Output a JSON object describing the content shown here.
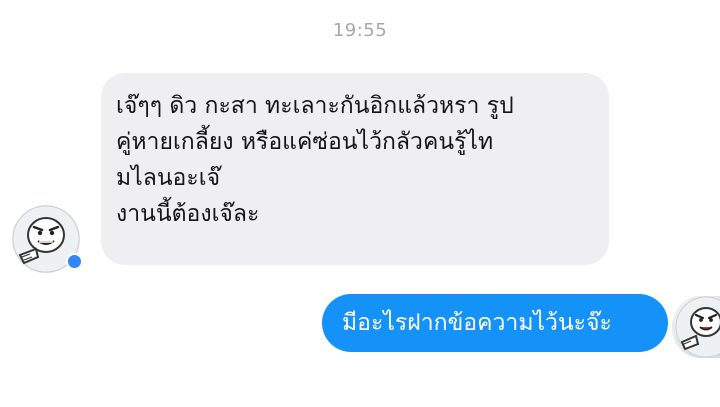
{
  "chat": {
    "timestamp": "19:55",
    "messages": [
      {
        "direction": "incoming",
        "text": "เจ๊ๆๆ ดิว กะสา ทะเลาะกันอิกแล้วหรา รูป\nคู่หายเกลี้ยง หรือแค่ซ่อนไว้กลัวคนรู้ไท\nมไลนอะเจ๊\nงานนี้ต้องเจ๊ละ"
      },
      {
        "direction": "outgoing",
        "text": "มีอะไรฝากข้อความไว้นะจ๊ะ"
      }
    ],
    "contact_avatar_icon": "cartoon-character-icon",
    "self_avatar_icon": "cartoon-character-icon",
    "colors": {
      "incoming_bubble": "#efeff1",
      "outgoing_bubble": "#1592f8",
      "online_dot": "#2f86f6"
    }
  }
}
